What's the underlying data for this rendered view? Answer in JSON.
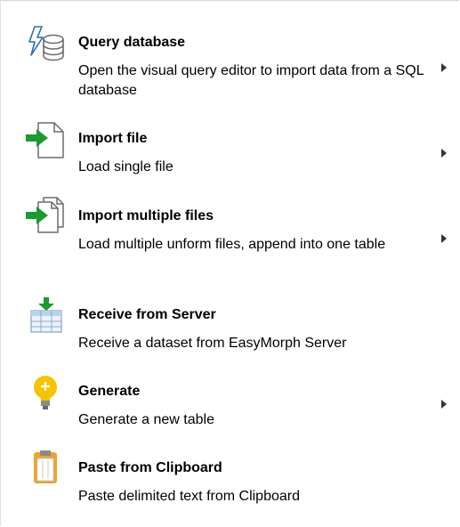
{
  "menu": {
    "items": [
      {
        "title": "Query database",
        "description": "Open the visual query editor to import data from a SQL database",
        "icon": "database-query-icon",
        "has_submenu": true
      },
      {
        "title": "Import file",
        "description": "Load single file",
        "icon": "import-file-icon",
        "has_submenu": true
      },
      {
        "title": "Import multiple files",
        "description": "Load multiple unform files, append into one table",
        "icon": "import-multiple-files-icon",
        "has_submenu": true
      },
      {
        "title": "Receive from Server",
        "description": "Receive a dataset from EasyMorph Server",
        "icon": "receive-server-icon",
        "has_submenu": false
      },
      {
        "title": "Generate",
        "description": "Generate a new table",
        "icon": "lightbulb-icon",
        "has_submenu": true
      },
      {
        "title": "Paste from Clipboard",
        "description": "Paste delimited text from Clipboard",
        "icon": "clipboard-icon",
        "has_submenu": false
      }
    ]
  },
  "colors": {
    "arrow_green": "#1a9b2e",
    "icon_gray": "#6b6b6b",
    "bulb_yellow": "#f5c400",
    "clipboard_orange": "#f0a22a",
    "database_blue": "#2b6cb0"
  }
}
